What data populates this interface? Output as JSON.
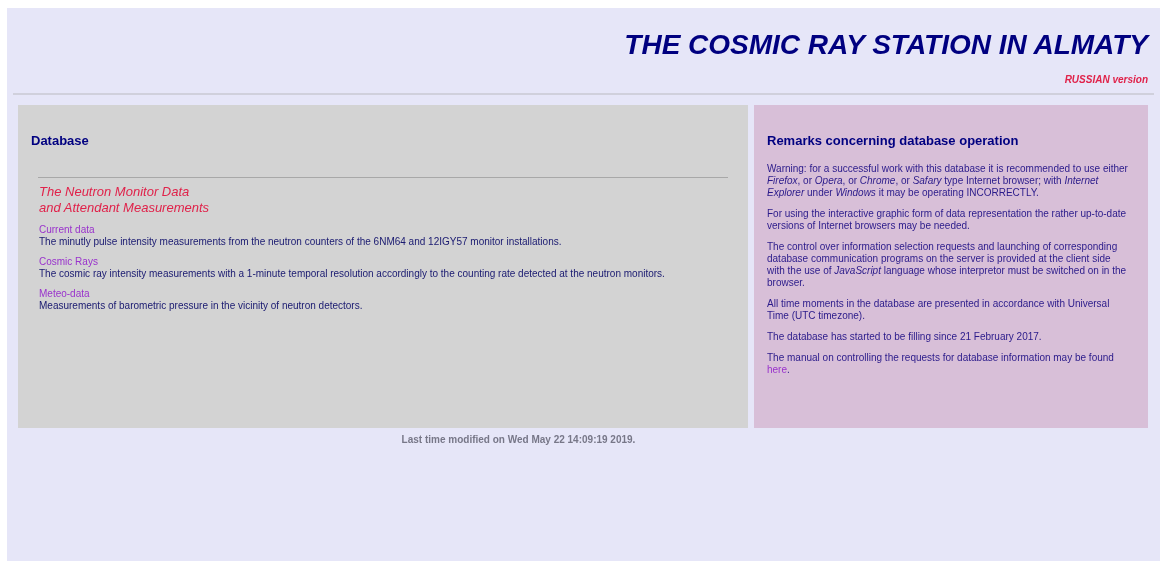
{
  "header": {
    "title": "THE COSMIC RAY STATION IN ALMATY",
    "language_link": "RUSSIAN version"
  },
  "database": {
    "heading": "Database",
    "subtitle_lines": [
      "The Neutron Monitor Data",
      "and Attendant Measurements"
    ],
    "items": [
      {
        "link": "Current data",
        "description": "The minutly pulse intensity measurements from the neutron counters of the 6NM64 and 12IGY57 monitor installations."
      },
      {
        "link": "Cosmic Rays",
        "description": "The cosmic ray intensity measurements with a 1-minute temporal resolution accordingly to the counting rate detected at the neutron monitors."
      },
      {
        "link": "Meteo-data",
        "description": "Measurements of barometric pressure in the vicinity of neutron detectors."
      }
    ]
  },
  "remarks": {
    "heading": "Remarks concerning database operation",
    "paragraphs": [
      "Warning: for a successful work with this database it is recommended to use either *Firefox*, or *Opera*, or *Chrome*, or *Safary* type Internet browser; with *Internet Explorer* under *Windows* it may be operating INCORRECTLY.",
      "For using the interactive graphic form of data representation the rather up-to-date versions of Internet browsers may be needed.",
      "The control over information selection requests and launching of corresponding database communication programs on the server is provided at the client side with the use of *JavaScript* language whose interpretor must be switched on in the browser.",
      "All time moments in the database are presented in accordance with Universal Time (UTC timezone).",
      "The database has started to be filling since 21 February 2017."
    ],
    "manual": {
      "text": "The manual on controlling the requests for database information may be found",
      "link": "here",
      "end": "."
    }
  },
  "footer": "Last time modified on Wed May 22 14:09:19 2019."
}
